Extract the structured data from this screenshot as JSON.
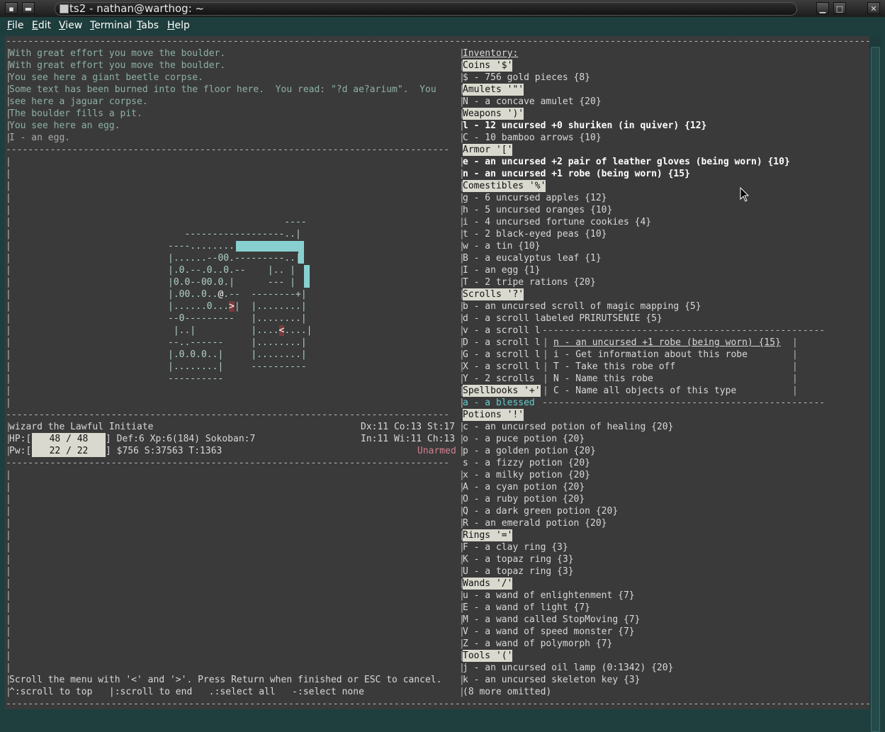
{
  "window": {
    "title": "ts2 - nathan@warthog: ~"
  },
  "menu": [
    "File",
    "Edit",
    "View",
    "Terminal",
    "Tabs",
    "Help"
  ],
  "messages": [
    "With great effort you move the boulder.",
    "With great effort you move the boulder.",
    "You see here a giant beetle corpse.",
    "Some text has been burned into the floor here.  You read: \"?d ae?arium\".  You",
    "see here a jaguar corpse.",
    "The boulder fills a pit.",
    "You see here an egg.",
    "I - an egg."
  ],
  "map": [
    "                     ----",
    "   ------------------..|",
    "----........         ..",
    "|......--00.---------..|",
    "|.0.--.0..0.--    |.. |",
    "|0.0--00.0.|      --- |",
    "|.00..0..@.--  --------+|",
    "|......0...>|  |........|",
    "--0---------   |........|",
    " |..|          |....<....|",
    "--..------     |........|",
    "|.0.0.0..|     |........|",
    "|........|     ----------",
    "----------"
  ],
  "status": {
    "name": "wizard the Lawful Initiate",
    "attrs1": "Dx:11 Co:13 St:17",
    "hp_label": "HP:[",
    "hp_value": " 48 / 48 ",
    "def": "] Def:6 Xp:6(184) Sokoban:7",
    "attrs2": "In:11 Wi:11 Ch:13",
    "pw_label": "Pw:[",
    "pw_value": " 22 / 22 ",
    "misc": "] $756 S:37563 T:1363",
    "weapon": "Unarmed"
  },
  "help": {
    "line1": "Scroll the menu with '<' and '>'. Press Return when finished or ESC to cancel.",
    "line2": "^:scroll to top   |:scroll to end   .:select all   -:select none"
  },
  "inventory": {
    "title": "Inventory:",
    "lines": [
      {
        "kind": "head",
        "text": "Coins '$'"
      },
      {
        "kind": "item",
        "text": "$ - 756 gold pieces {8}"
      },
      {
        "kind": "head",
        "text": "Amulets '\"'"
      },
      {
        "kind": "item",
        "text": "N - a concave amulet {20}"
      },
      {
        "kind": "head",
        "text": "Weapons ')'"
      },
      {
        "kind": "bold",
        "text": "l - 12 uncursed +0 shuriken (in quiver) {12}"
      },
      {
        "kind": "item",
        "text": "C - 10 bamboo arrows {10}"
      },
      {
        "kind": "head",
        "text": "Armor '['"
      },
      {
        "kind": "bold",
        "text": "e - an uncursed +2 pair of leather gloves (being worn) {10}"
      },
      {
        "kind": "bold",
        "text": "n - an uncursed +1 robe (being worn) {15}"
      },
      {
        "kind": "head",
        "text": "Comestibles '%'"
      },
      {
        "kind": "item",
        "text": "g - 6 uncursed apples {12}"
      },
      {
        "kind": "item",
        "text": "h - 5 uncursed oranges {10}"
      },
      {
        "kind": "item",
        "text": "i - 4 uncursed fortune cookies {4}"
      },
      {
        "kind": "item",
        "text": "t - 2 black-eyed peas {10}"
      },
      {
        "kind": "item",
        "text": "w - a tin {10}"
      },
      {
        "kind": "item",
        "text": "B - a eucalyptus leaf {1}"
      },
      {
        "kind": "item",
        "text": "I - an egg {1}"
      },
      {
        "kind": "item",
        "text": "T - 2 tripe rations {20}"
      },
      {
        "kind": "head",
        "text": "Scrolls '?'"
      },
      {
        "kind": "item",
        "text": "b - an uncursed scroll of magic mapping {5}"
      },
      {
        "kind": "item",
        "text": "d - a scroll labeled PRIRUTSENIE {5}"
      },
      {
        "kind": "item",
        "text": "v - a scroll l"
      },
      {
        "kind": "item",
        "text": "D - a scroll l"
      },
      {
        "kind": "item",
        "text": "G - a scroll l"
      },
      {
        "kind": "item",
        "text": "X - a scroll l"
      },
      {
        "kind": "item",
        "text": "Y - 2 scrolls"
      },
      {
        "kind": "head",
        "text": "Spellbooks '+'"
      },
      {
        "kind": "cyan",
        "text": "a - a blessed"
      },
      {
        "kind": "head",
        "text": "Potions '!'"
      },
      {
        "kind": "item",
        "text": "c - an uncursed potion of healing {20}"
      },
      {
        "kind": "item",
        "text": "o - a puce potion {20}"
      },
      {
        "kind": "item",
        "text": "p - a golden potion {20}"
      },
      {
        "kind": "item",
        "text": "s - a fizzy potion {20}"
      },
      {
        "kind": "item",
        "text": "x - a milky potion {20}"
      },
      {
        "kind": "item",
        "text": "A - a cyan potion {20}"
      },
      {
        "kind": "item",
        "text": "O - a ruby potion {20}"
      },
      {
        "kind": "item",
        "text": "Q - a dark green potion {20}"
      },
      {
        "kind": "item",
        "text": "R - an emerald potion {20}"
      },
      {
        "kind": "head",
        "text": "Rings '='"
      },
      {
        "kind": "item",
        "text": "F - a clay ring {3}"
      },
      {
        "kind": "item",
        "text": "K - a topaz ring {3}"
      },
      {
        "kind": "item",
        "text": "U - a topaz ring {3}"
      },
      {
        "kind": "head",
        "text": "Wands '/'"
      },
      {
        "kind": "item",
        "text": "u - a wand of enlightenment {7}"
      },
      {
        "kind": "item",
        "text": "E - a wand of light {7}"
      },
      {
        "kind": "item",
        "text": "M - a wand called StopMoving {7}"
      },
      {
        "kind": "item",
        "text": "V - a wand of speed monster {7}"
      },
      {
        "kind": "item",
        "text": "Z - a wand of polymorph {7}"
      },
      {
        "kind": "head",
        "text": "Tools '('"
      },
      {
        "kind": "item",
        "text": "j - an uncursed oil lamp (0:1342) {20}"
      },
      {
        "kind": "item",
        "text": "k - an uncursed skeleton key {3}"
      },
      {
        "kind": "item",
        "text": "(8 more omitted)"
      }
    ]
  },
  "popup": {
    "header": "n - an uncursed +1 robe (being worn) {15}",
    "options": [
      "i - Get information about this robe",
      "T - Take this robe off",
      "N - Name this robe",
      "C - Name all objects of this type"
    ]
  }
}
